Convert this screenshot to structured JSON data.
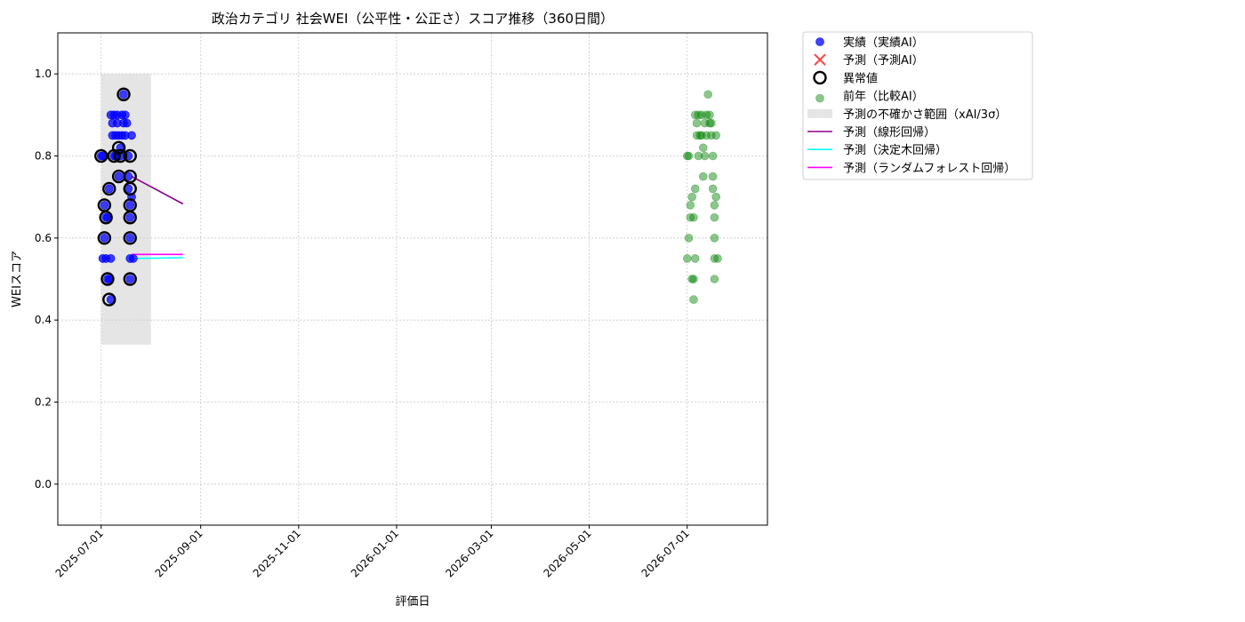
{
  "chart_data": {
    "type": "scatter",
    "title": "政治カテゴリ 社会WEI（公平性・公正さ）スコア推移（360日間）",
    "xlabel": "評価日",
    "ylabel": "WEIスコア",
    "xlim": [
      "2025-06-04",
      "2026-08-20"
    ],
    "ylim": [
      -0.1,
      1.1
    ],
    "yticks": [
      0.0,
      0.2,
      0.4,
      0.6,
      0.8,
      1.0
    ],
    "ytick_labels": [
      "0.0",
      "0.2",
      "0.4",
      "0.6",
      "0.8",
      "1.0"
    ],
    "xticks": [
      "2025-07-01",
      "2025-09-01",
      "2025-11-01",
      "2026-01-01",
      "2026-03-01",
      "2026-05-01",
      "2026-07-01"
    ],
    "grid": true,
    "legend_position": "outside-top-right",
    "legend": [
      {
        "label": "実績（実績AI）",
        "kind": "dot",
        "color": "#0000ff"
      },
      {
        "label": "予測（予測AI）",
        "kind": "x",
        "color": "#ff0000"
      },
      {
        "label": "異常値",
        "kind": "ring",
        "color": "#000000"
      },
      {
        "label": "前年（比較AI）",
        "kind": "dot-faint",
        "color": "#008000"
      },
      {
        "label": "予測の不確かさ範囲（xAI/3σ）",
        "kind": "band",
        "color": "#cccccc"
      },
      {
        "label": "予測（線形回帰）",
        "kind": "line",
        "color": "#8b008b"
      },
      {
        "label": "予測（決定木回帰）",
        "kind": "line",
        "color": "#00ffff"
      },
      {
        "label": "予測（ランダムフォレスト回帰）",
        "kind": "line",
        "color": "#ff00ff"
      }
    ],
    "uncertainty_band": {
      "x": [
        "2025-07-01",
        "2025-08-01"
      ],
      "y": [
        0.34,
        1.0
      ]
    },
    "series": [
      {
        "name": "実績（実績AI）",
        "color": "#0000ff",
        "points": [
          [
            "2025-07-01",
            0.8
          ],
          [
            "2025-07-02",
            0.8
          ],
          [
            "2025-07-02",
            0.55
          ],
          [
            "2025-07-03",
            0.68
          ],
          [
            "2025-07-03",
            0.6
          ],
          [
            "2025-07-04",
            0.65
          ],
          [
            "2025-07-04",
            0.55
          ],
          [
            "2025-07-05",
            0.5
          ],
          [
            "2025-07-05",
            0.65
          ],
          [
            "2025-07-06",
            0.72
          ],
          [
            "2025-07-06",
            0.5
          ],
          [
            "2025-07-07",
            0.45
          ],
          [
            "2025-07-07",
            0.55
          ],
          [
            "2025-07-07",
            0.9
          ],
          [
            "2025-07-08",
            0.88
          ],
          [
            "2025-07-08",
            0.85
          ],
          [
            "2025-07-09",
            0.9
          ],
          [
            "2025-07-09",
            0.8
          ],
          [
            "2025-07-10",
            0.85
          ],
          [
            "2025-07-10",
            0.8
          ],
          [
            "2025-07-11",
            0.9
          ],
          [
            "2025-07-11",
            0.88
          ],
          [
            "2025-07-12",
            0.75
          ],
          [
            "2025-07-12",
            0.85
          ],
          [
            "2025-07-13",
            0.82
          ],
          [
            "2025-07-13",
            0.8
          ],
          [
            "2025-07-14",
            0.9
          ],
          [
            "2025-07-14",
            0.85
          ],
          [
            "2025-07-15",
            0.95
          ],
          [
            "2025-07-15",
            0.88
          ],
          [
            "2025-07-16",
            0.9
          ],
          [
            "2025-07-16",
            0.85
          ],
          [
            "2025-07-17",
            0.88
          ],
          [
            "2025-07-18",
            0.8
          ],
          [
            "2025-07-18",
            0.75
          ],
          [
            "2025-07-18",
            0.72
          ],
          [
            "2025-07-19",
            0.68
          ],
          [
            "2025-07-19",
            0.65
          ],
          [
            "2025-07-19",
            0.6
          ],
          [
            "2025-07-19",
            0.55
          ],
          [
            "2025-07-19",
            0.5
          ],
          [
            "2025-07-20",
            0.7
          ],
          [
            "2025-07-20",
            0.85
          ],
          [
            "2025-07-21",
            0.55
          ]
        ]
      },
      {
        "name": "異常値",
        "color": "#000000",
        "points": [
          [
            "2025-07-01",
            0.8
          ],
          [
            "2025-07-03",
            0.68
          ],
          [
            "2025-07-03",
            0.6
          ],
          [
            "2025-07-04",
            0.65
          ],
          [
            "2025-07-05",
            0.5
          ],
          [
            "2025-07-06",
            0.72
          ],
          [
            "2025-07-06",
            0.45
          ],
          [
            "2025-07-09",
            0.8
          ],
          [
            "2025-07-12",
            0.75
          ],
          [
            "2025-07-12",
            0.82
          ],
          [
            "2025-07-13",
            0.8
          ],
          [
            "2025-07-15",
            0.95
          ],
          [
            "2025-07-19",
            0.8
          ],
          [
            "2025-07-19",
            0.75
          ],
          [
            "2025-07-19",
            0.72
          ],
          [
            "2025-07-19",
            0.68
          ],
          [
            "2025-07-19",
            0.65
          ],
          [
            "2025-07-19",
            0.6
          ],
          [
            "2025-07-19",
            0.5
          ]
        ]
      },
      {
        "name": "前年（比較AI）",
        "color": "#008000",
        "points": [
          [
            "2026-07-01",
            0.8
          ],
          [
            "2026-07-01",
            0.55
          ],
          [
            "2026-07-02",
            0.6
          ],
          [
            "2026-07-02",
            0.8
          ],
          [
            "2026-07-03",
            0.68
          ],
          [
            "2026-07-03",
            0.65
          ],
          [
            "2026-07-04",
            0.5
          ],
          [
            "2026-07-04",
            0.7
          ],
          [
            "2026-07-05",
            0.65
          ],
          [
            "2026-07-05",
            0.5
          ],
          [
            "2026-07-05",
            0.45
          ],
          [
            "2026-07-06",
            0.72
          ],
          [
            "2026-07-06",
            0.55
          ],
          [
            "2026-07-06",
            0.9
          ],
          [
            "2026-07-07",
            0.88
          ],
          [
            "2026-07-07",
            0.85
          ],
          [
            "2026-07-08",
            0.9
          ],
          [
            "2026-07-08",
            0.8
          ],
          [
            "2026-07-09",
            0.85
          ],
          [
            "2026-07-10",
            0.9
          ],
          [
            "2026-07-10",
            0.85
          ],
          [
            "2026-07-11",
            0.75
          ],
          [
            "2026-07-11",
            0.82
          ],
          [
            "2026-07-12",
            0.88
          ],
          [
            "2026-07-12",
            0.8
          ],
          [
            "2026-07-13",
            0.9
          ],
          [
            "2026-07-13",
            0.85
          ],
          [
            "2026-07-14",
            0.95
          ],
          [
            "2026-07-15",
            0.88
          ],
          [
            "2026-07-15",
            0.9
          ],
          [
            "2026-07-16",
            0.85
          ],
          [
            "2026-07-16",
            0.88
          ],
          [
            "2026-07-17",
            0.8
          ],
          [
            "2026-07-17",
            0.75
          ],
          [
            "2026-07-17",
            0.72
          ],
          [
            "2026-07-18",
            0.68
          ],
          [
            "2026-07-18",
            0.65
          ],
          [
            "2026-07-18",
            0.6
          ],
          [
            "2026-07-18",
            0.55
          ],
          [
            "2026-07-18",
            0.5
          ],
          [
            "2026-07-19",
            0.7
          ],
          [
            "2026-07-19",
            0.85
          ],
          [
            "2026-07-20",
            0.55
          ]
        ]
      },
      {
        "name": "予測（線形回帰）",
        "color": "#8b008b",
        "points": [
          [
            "2025-07-20",
            0.75
          ],
          [
            "2025-08-21",
            0.683
          ]
        ]
      },
      {
        "name": "予測（決定木回帰）",
        "color": "#00ffff",
        "points": [
          [
            "2025-07-20",
            0.55
          ],
          [
            "2025-08-21",
            0.552
          ]
        ]
      },
      {
        "name": "予測（ランダムフォレスト回帰）",
        "color": "#ff00ff",
        "points": [
          [
            "2025-07-20",
            0.56
          ],
          [
            "2025-08-21",
            0.56
          ]
        ]
      }
    ]
  }
}
